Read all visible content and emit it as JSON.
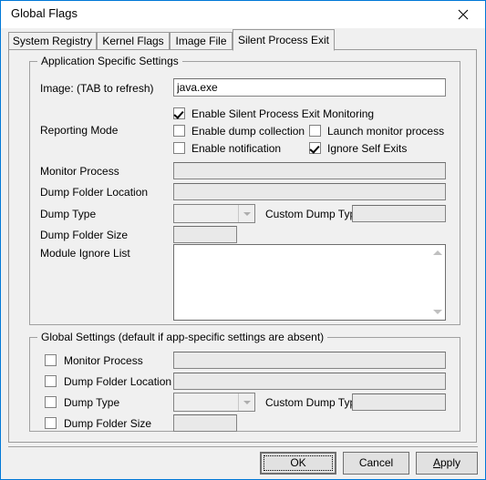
{
  "window": {
    "title": "Global Flags",
    "close_icon": "close-icon",
    "accent_color": "#0078d7",
    "background_color": "#f0f0f0"
  },
  "tabs": [
    {
      "label": "System Registry",
      "selected": false
    },
    {
      "label": "Kernel Flags",
      "selected": false
    },
    {
      "label": "Image File",
      "selected": false
    },
    {
      "label": "Silent Process Exit",
      "selected": true
    }
  ],
  "app_settings": {
    "group_title": "Application Specific Settings",
    "image_label": "Image:  (TAB to refresh)",
    "image_value": "java.exe",
    "reporting_mode_label": "Reporting Mode",
    "checkboxes": [
      {
        "label": "Enable Silent Process Exit Monitoring",
        "checked": true
      },
      {
        "label": "Enable dump collection",
        "checked": false
      },
      {
        "label": "Launch monitor process",
        "checked": false
      },
      {
        "label": "Enable notification",
        "checked": false
      },
      {
        "label": "Ignore Self Exits",
        "checked": true
      }
    ],
    "monitor_process_label": "Monitor Process",
    "monitor_process_value": "",
    "dump_folder_location_label": "Dump Folder Location",
    "dump_folder_location_value": "",
    "dump_type_label": "Dump Type",
    "dump_type_value": "",
    "custom_dump_type_label": "Custom Dump Type",
    "custom_dump_type_value": "",
    "dump_folder_size_label": "Dump Folder Size",
    "dump_folder_size_value": "",
    "module_ignore_list_label": "Module Ignore List",
    "module_ignore_list_value": ""
  },
  "global_settings": {
    "group_title": "Global Settings (default if app-specific settings are absent)",
    "rows": [
      {
        "label": "Monitor Process",
        "checked": false,
        "value": ""
      },
      {
        "label": "Dump Folder Location",
        "checked": false,
        "value": ""
      },
      {
        "label": "Dump Type",
        "checked": false,
        "value": ""
      },
      {
        "label": "Dump Folder Size",
        "checked": false,
        "value": ""
      }
    ],
    "custom_dump_type_label": "Custom Dump Type",
    "custom_dump_type_value": ""
  },
  "buttons": {
    "ok": "OK",
    "cancel": "Cancel",
    "apply_prefix": "A",
    "apply_rest": "pply"
  }
}
